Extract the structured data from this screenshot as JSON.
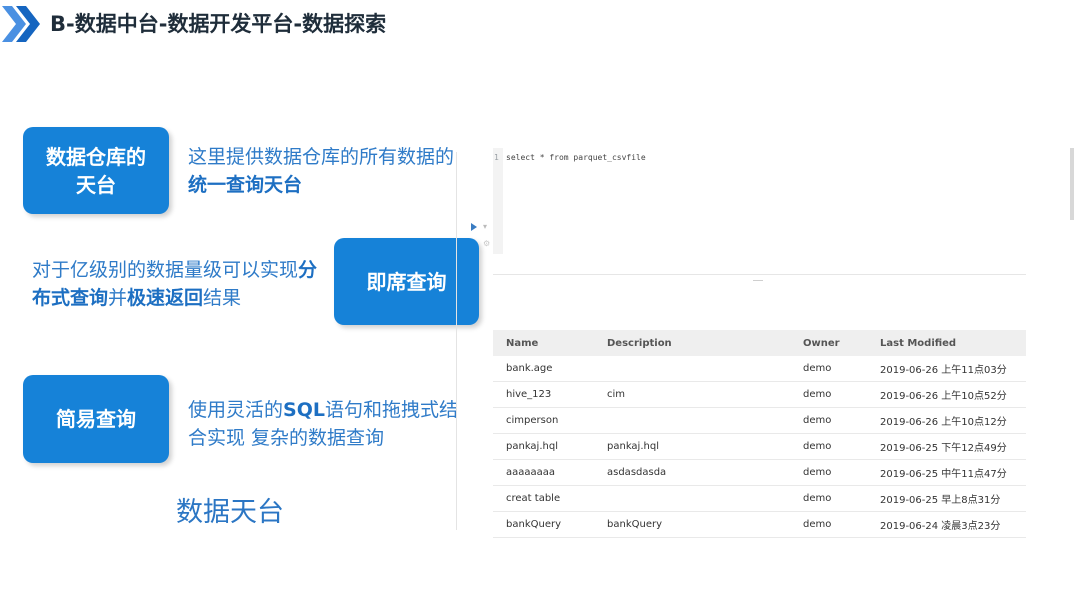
{
  "header": {
    "title": "B-数据中台-数据开发平台-数据探索"
  },
  "features": [
    {
      "label": "数据仓库的\n天台",
      "desc_pre": "这里提供数据仓库的所有数据的",
      "desc_bold": "统一查询天台",
      "desc_post": ""
    },
    {
      "label": "即席查询",
      "desc_pre": "对于亿级别的数据量级可以实现",
      "desc_bold": "分布式查询",
      "desc_mid": "并",
      "desc_bold2": "极速返回",
      "desc_post": "结果"
    },
    {
      "label": "简易查询",
      "desc_pre": "使用灵活的",
      "desc_bold": "SQL",
      "desc_post": "语句和拖拽式结合实现 复杂的数据查询"
    }
  ],
  "caption": "数据天台",
  "editor": {
    "line_number": "1",
    "code": "select * from parquet_csvfile"
  },
  "table": {
    "columns": [
      "Name",
      "Description",
      "Owner",
      "Last Modified"
    ],
    "rows": [
      [
        "bank.age",
        "",
        "demo",
        "2019-06-26 上午11点03分"
      ],
      [
        "hive_123",
        "cim",
        "demo",
        "2019-06-26 上午10点52分"
      ],
      [
        "cimperson",
        "",
        "demo",
        "2019-06-26 上午10点12分"
      ],
      [
        "pankaj.hql",
        "pankaj.hql",
        "demo",
        "2019-06-25 下午12点49分"
      ],
      [
        "aaaaaaaa",
        "asdasdasda",
        "demo",
        "2019-06-25 中午11点47分"
      ],
      [
        "creat table",
        "",
        "demo",
        "2019-06-25 早上8点31分"
      ],
      [
        "bankQuery",
        "bankQuery",
        "demo",
        "2019-06-24 凌晨3点23分"
      ]
    ]
  },
  "colors": {
    "accent": "#1682d8",
    "text_blue": "#2f7bc8"
  }
}
